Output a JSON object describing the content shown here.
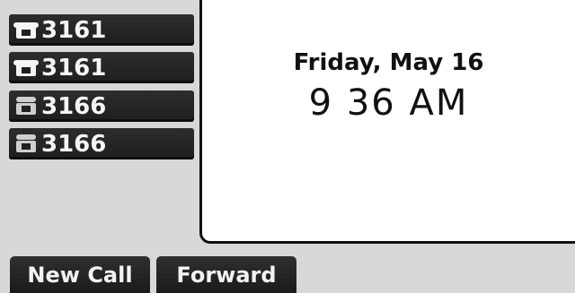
{
  "lines": [
    {
      "label": "3161",
      "icon": "phone-icon",
      "state": "active"
    },
    {
      "label": "3161",
      "icon": "phone-icon",
      "state": "active"
    },
    {
      "label": "3166",
      "icon": "phone-icon",
      "state": "inactive"
    },
    {
      "label": "3166",
      "icon": "phone-icon",
      "state": "inactive"
    }
  ],
  "display": {
    "date": "Friday, May 16",
    "time": "9 36 AM"
  },
  "softkeys": [
    {
      "label": "New Call"
    },
    {
      "label": "Forward"
    }
  ],
  "colors": {
    "key_bg": "#1f1f1f",
    "screen_bg": "#ffffff",
    "panel_bg": "#d8d8d8",
    "text_light": "#f5f5f5"
  }
}
